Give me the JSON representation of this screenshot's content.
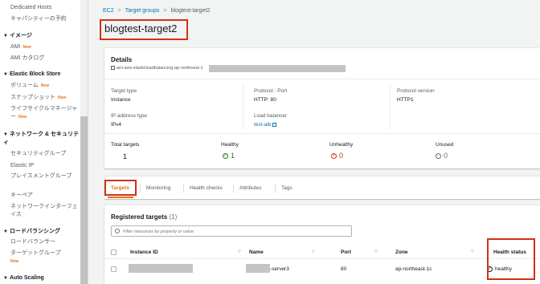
{
  "sidebar": {
    "items_top": [
      "Dedicated Hosts",
      "キャパシティーの予約"
    ],
    "sections": [
      {
        "label": "イメージ",
        "items": [
          {
            "label": "AMI",
            "new": "New"
          },
          {
            "label": "AMI カタログ"
          }
        ]
      },
      {
        "label": "Elastic Block Store",
        "items": [
          {
            "label": "ボリューム",
            "new": "New"
          },
          {
            "label": "スナップショット",
            "new": "New"
          },
          {
            "label": "ライフサイクルマネージャー",
            "new": "New"
          }
        ]
      },
      {
        "label": "ネットワーク & セキュリティ",
        "items": [
          {
            "label": "セキュリティグループ"
          },
          {
            "label": "Elastic IP"
          },
          {
            "label": "プレイスメントグループ"
          },
          {
            "label": "キーペア"
          },
          {
            "label": "ネットワークインターフェイス"
          }
        ]
      },
      {
        "label": "ロードバランシング",
        "items": [
          {
            "label": "ロードバランサー"
          },
          {
            "label": "ターゲットグループ",
            "new": "New"
          }
        ]
      },
      {
        "label": "Auto Scaling",
        "items": []
      }
    ]
  },
  "breadcrumb": {
    "items": [
      "EC2",
      "Target groups",
      "blogtest-target2"
    ]
  },
  "page_title": "blogtest-target2",
  "details": {
    "title": "Details",
    "arn": "arn:aws:elasticloadbalancing:ap-northeast-1",
    "target_type_label": "Target type",
    "target_type": "Instance",
    "protocol_port_label": "Protocol : Port",
    "protocol_port": "HTTP: 80",
    "protocol_version_label": "Protocol version",
    "protocol_version": "HTTP1",
    "ip_type_label": "IP address type",
    "ip_type": "IPv4",
    "lb_label": "Load balancer",
    "lb": "test-alb",
    "stats": {
      "total_label": "Total targets",
      "total": "1",
      "healthy_label": "Healthy",
      "healthy": "1",
      "unhealthy_label": "Unhealthy",
      "unhealthy": "0",
      "unused_label": "Unused",
      "unused": "0"
    }
  },
  "tabs": [
    "Targets",
    "Monitoring",
    "Health checks",
    "Attributes",
    "Tags"
  ],
  "targets": {
    "title": "Registered targets",
    "count": "(1)",
    "filter_placeholder": "Filter resources by property or value",
    "columns": [
      "Instance ID",
      "Name",
      "Port",
      "Zone",
      "Health status"
    ],
    "rows": [
      {
        "name_suffix": "-server3",
        "port": "80",
        "zone": "ap-northeast-1c",
        "health": "healthy"
      }
    ]
  },
  "colors": {
    "accent": "#ec7211",
    "link": "#0073bb",
    "healthy": "#1d8102",
    "unhealthy": "#d13212",
    "highlight": "#d13212"
  }
}
